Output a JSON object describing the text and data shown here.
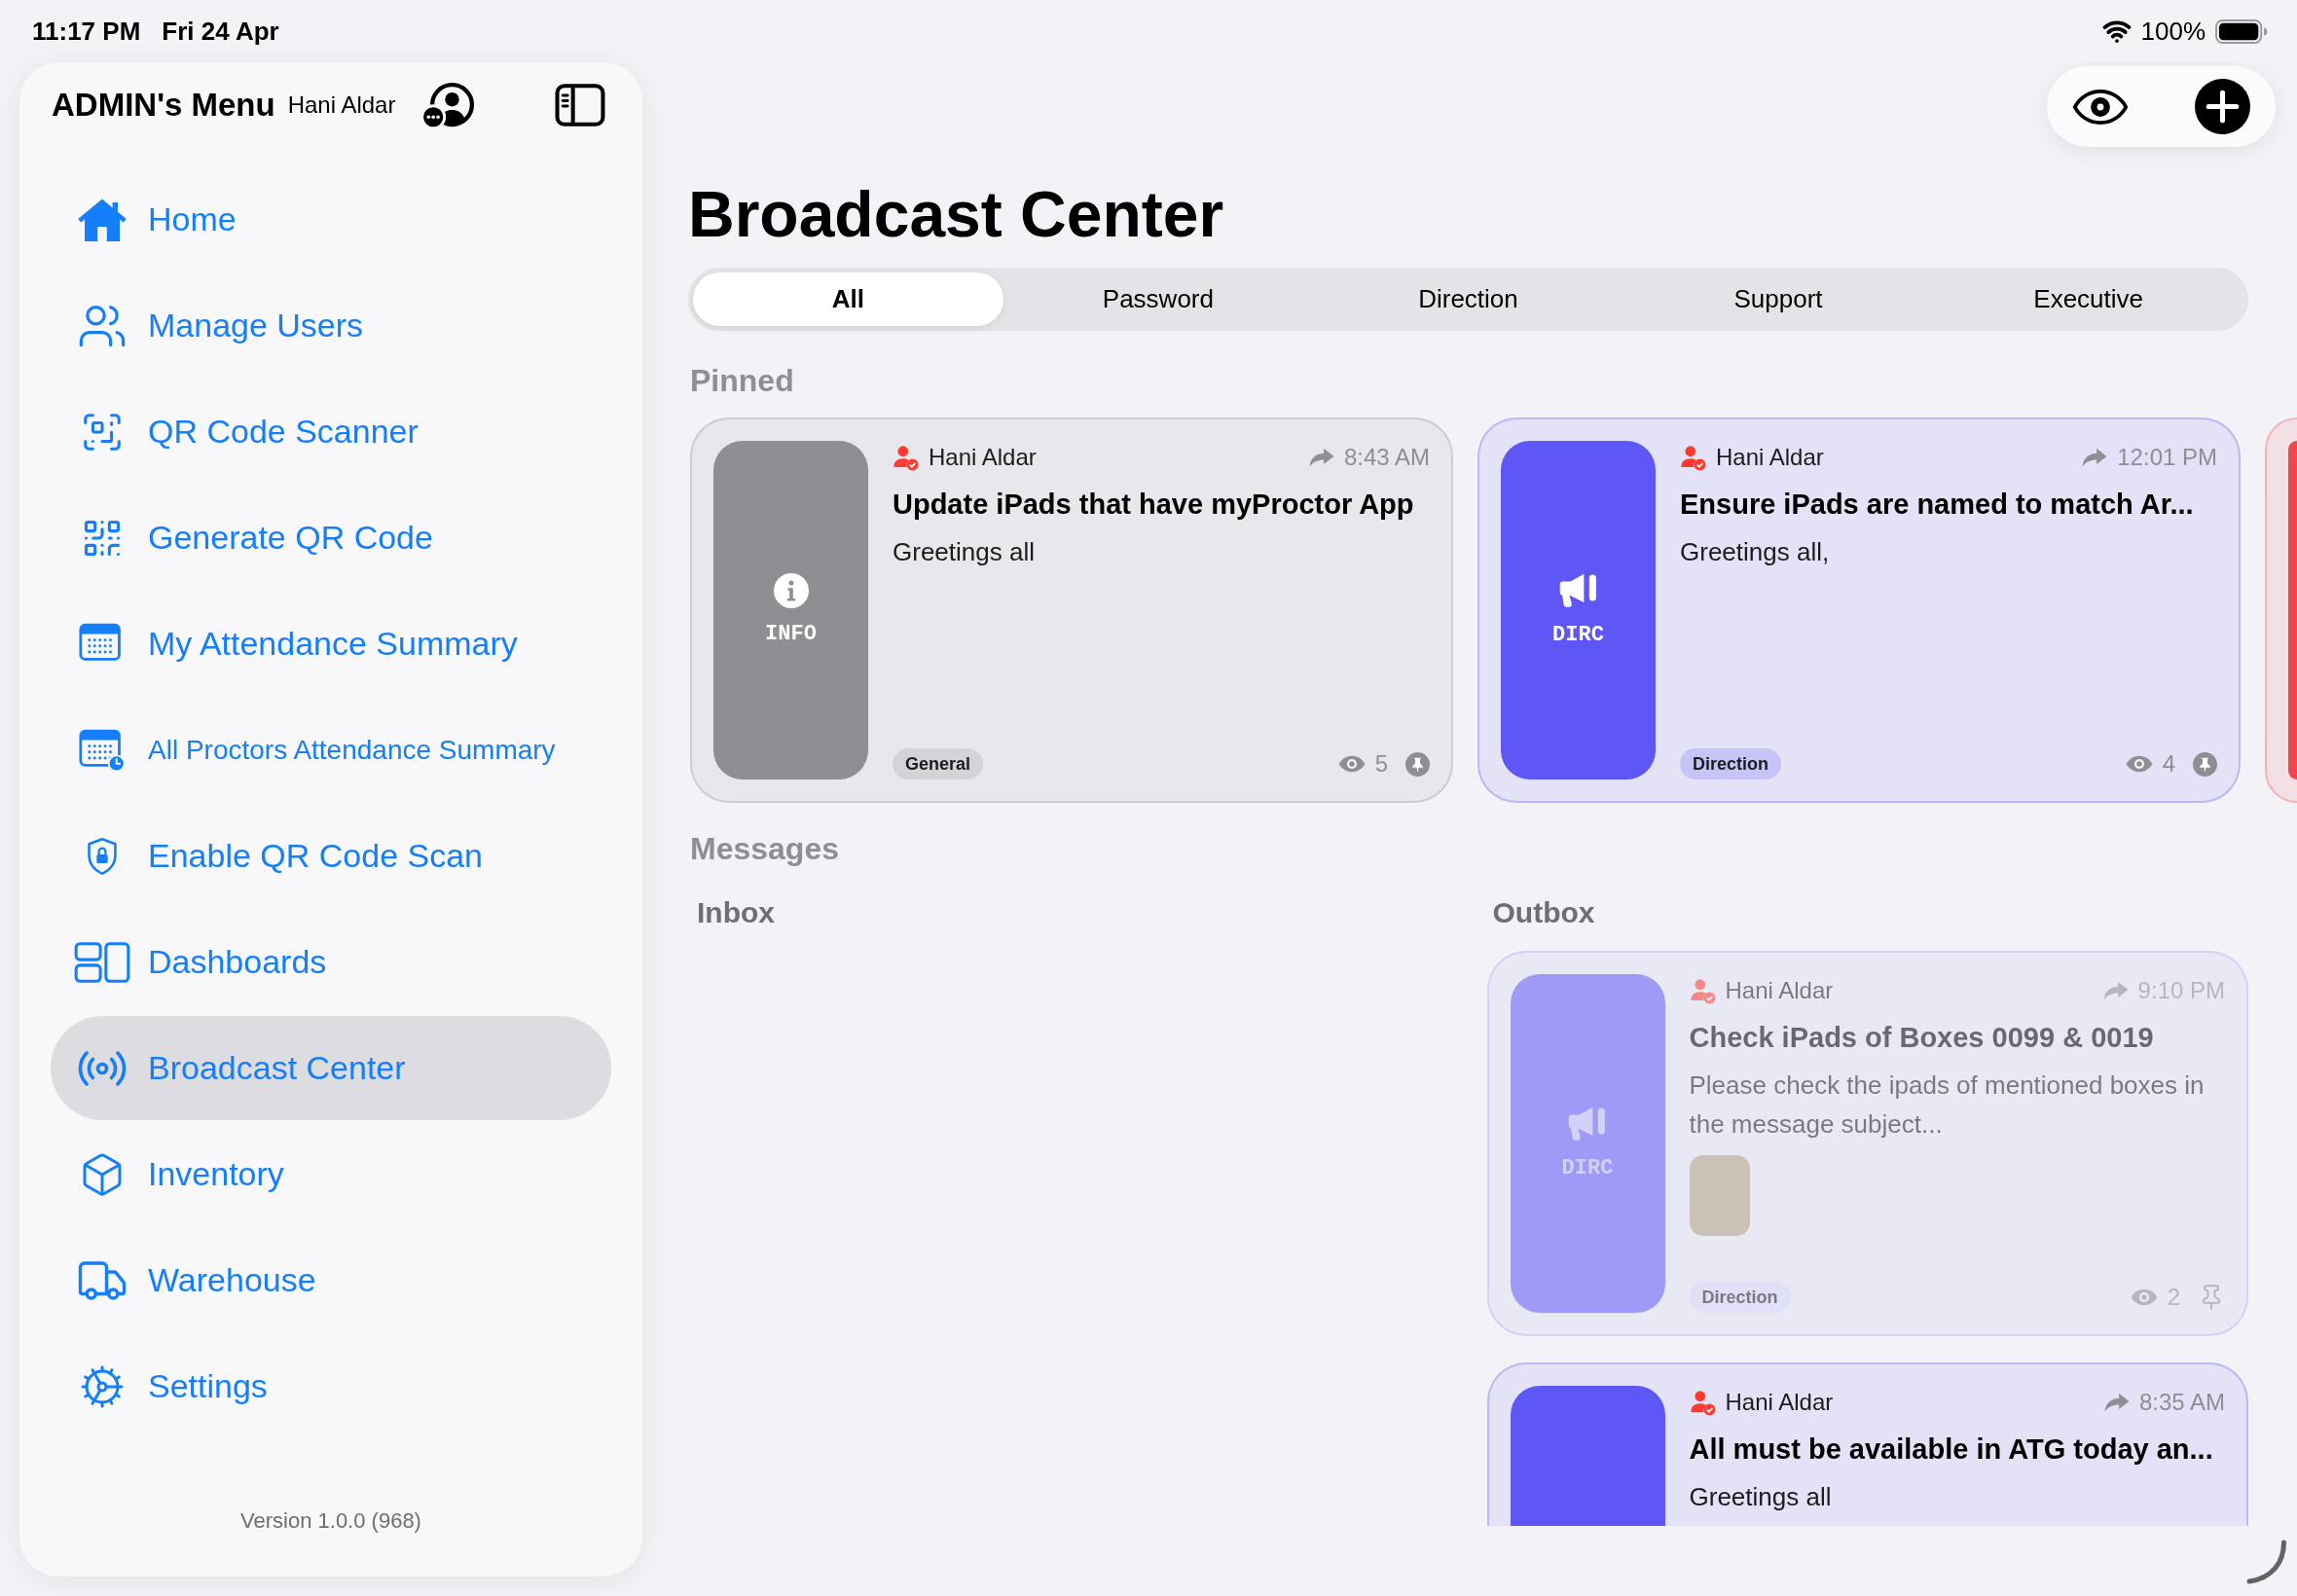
{
  "status_bar": {
    "time": "11:17 PM",
    "date": "Fri 24 Apr",
    "battery": "100%"
  },
  "sidebar": {
    "title": "ADMIN's Menu",
    "user": "Hani Aldar",
    "items": [
      {
        "label": "Home",
        "selected": false
      },
      {
        "label": "Manage Users",
        "selected": false
      },
      {
        "label": "QR Code Scanner",
        "selected": false
      },
      {
        "label": "Generate QR Code",
        "selected": false
      },
      {
        "label": "My Attendance Summary",
        "selected": false
      },
      {
        "label": "All Proctors Attendance Summary",
        "selected": false
      },
      {
        "label": "Enable QR Code Scan",
        "selected": false
      },
      {
        "label": "Dashboards",
        "selected": false
      },
      {
        "label": "Broadcast Center",
        "selected": true
      },
      {
        "label": "Inventory",
        "selected": false
      },
      {
        "label": "Warehouse",
        "selected": false
      },
      {
        "label": "Settings",
        "selected": false
      }
    ],
    "version": "Version 1.0.0 (968)"
  },
  "page": {
    "title": "Broadcast Center"
  },
  "tabs": [
    {
      "label": "All",
      "selected": true
    },
    {
      "label": "Password",
      "selected": false
    },
    {
      "label": "Direction",
      "selected": false
    },
    {
      "label": "Support",
      "selected": false
    },
    {
      "label": "Executive",
      "selected": false
    }
  ],
  "pinned": {
    "heading": "Pinned",
    "cards": [
      {
        "kind": "info",
        "color": "#8e8e93",
        "tile_label": "INFO",
        "author": "Hani Aldar",
        "time": "8:43 AM",
        "title": "Update iPads that have myProctor App",
        "body": "Greetings all",
        "tag": "General",
        "views": "5",
        "pinned": true
      },
      {
        "kind": "direction",
        "color": "#5e57f5",
        "tile_label": "DIRC",
        "author": "Hani Aldar",
        "time": "12:01 PM",
        "title": "Ensure iPads are named to match Ar...",
        "body": "Greetings all,",
        "tag": "Direction",
        "views": "4",
        "pinned": true
      },
      {
        "color": "#f2474a"
      }
    ]
  },
  "messages": {
    "heading": "Messages",
    "inbox": {
      "heading": "Inbox"
    },
    "outbox": {
      "heading": "Outbox",
      "cards": [
        {
          "kind": "direction",
          "color": "#9f9af5",
          "tile_label": "DIRC",
          "author": "Hani Aldar",
          "time": "9:10 PM",
          "title": "Check iPads of Boxes 0099 & 0019",
          "body": "Please check the ipads of mentioned boxes in the message subject...",
          "attachment": true,
          "tag": "Direction",
          "views": "2",
          "pinned": false,
          "faded": true
        },
        {
          "color": "#5e57f5",
          "author": "Hani Aldar",
          "time": "8:35 AM",
          "title": "All must be available in ATG today an...",
          "body": "Greetings all",
          "faded": false
        }
      ]
    }
  }
}
